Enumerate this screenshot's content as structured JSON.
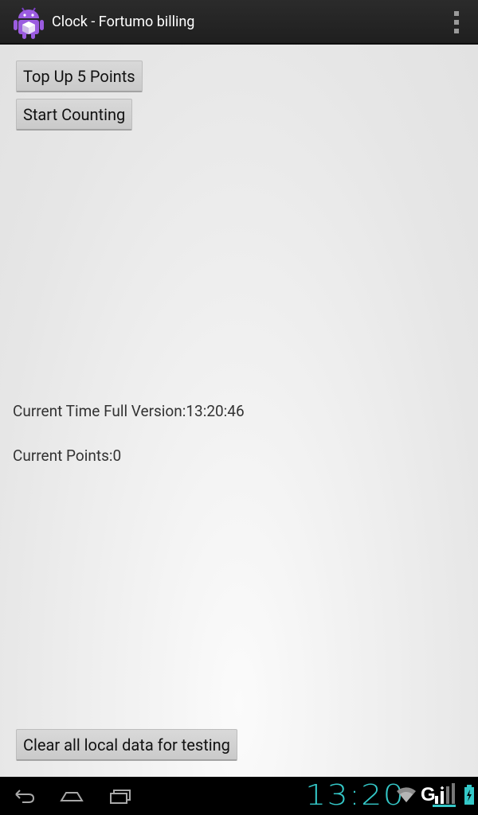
{
  "action_bar": {
    "title": "Clock - Fortumo billing",
    "app_icon": "android-icon",
    "overflow_icon": "overflow-menu-icon"
  },
  "main": {
    "top_up_button": "Top Up 5 Points",
    "start_counting_button": "Start Counting",
    "current_time": "Current Time Full Version:13:20:46",
    "current_points": "Current Points:0",
    "clear_data_button": "Clear all local data for testing"
  },
  "nav_bar": {
    "back_icon": "back-icon",
    "home_icon": "home-icon",
    "recents_icon": "recent-apps-icon"
  },
  "status": {
    "time": "13:20",
    "network_label": "G",
    "wifi_icon": "wifi-icon",
    "signal_icon": "signal-icon",
    "battery_icon": "battery-charging-icon",
    "accent_color": "#34c8c8"
  }
}
